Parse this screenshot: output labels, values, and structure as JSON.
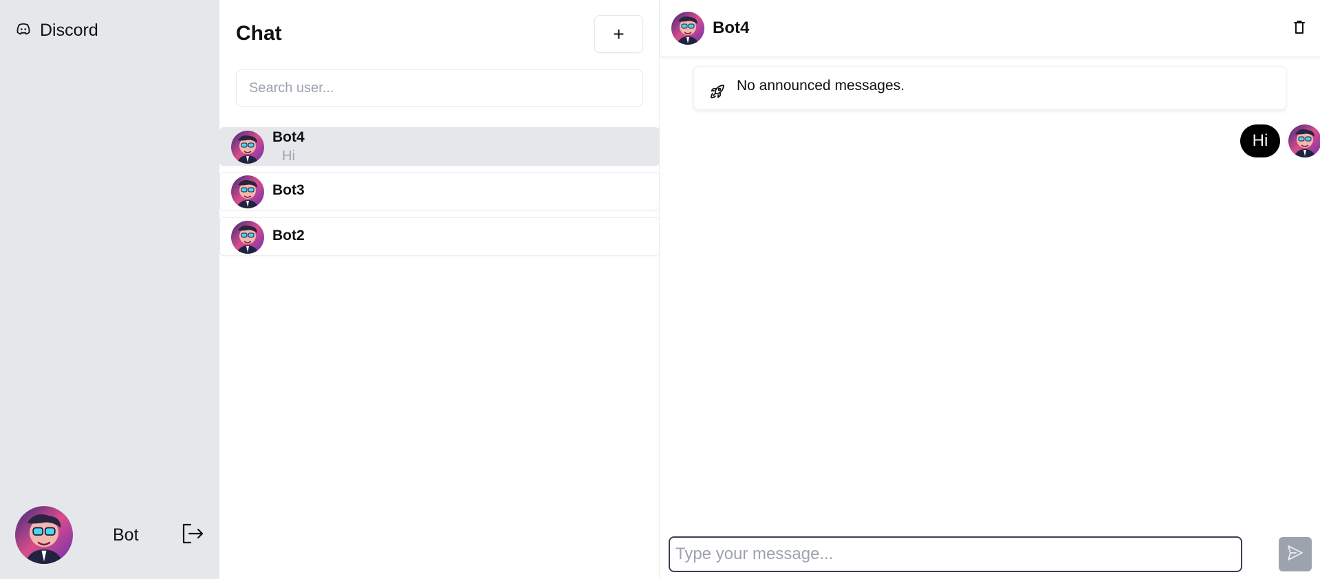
{
  "app": {
    "brand": "Discord"
  },
  "user": {
    "name": "Bot"
  },
  "chat_list": {
    "title": "Chat",
    "add_label": "+",
    "search_placeholder": "Search user...",
    "contacts": [
      {
        "name": "Bot4",
        "last_message": "Hi",
        "active": true
      },
      {
        "name": "Bot3",
        "last_message": "",
        "active": false
      },
      {
        "name": "Bot2",
        "last_message": "",
        "active": false
      }
    ]
  },
  "conversation": {
    "title": "Bot4",
    "announcement": "No announced messages.",
    "messages": [
      {
        "text": "Hi",
        "from_me": true
      }
    ],
    "composer_placeholder": "Type your message..."
  },
  "icons": {
    "brand": "discord-icon",
    "logout": "logout-icon",
    "delete": "trash-icon",
    "announcement": "rocket-icon",
    "send": "send-icon"
  },
  "colors": {
    "sidebar_bg": "#e5e7eb",
    "active_item_bg": "#e5e7eb",
    "bubble_bg": "#000000",
    "send_button_bg": "#9ca3af"
  }
}
